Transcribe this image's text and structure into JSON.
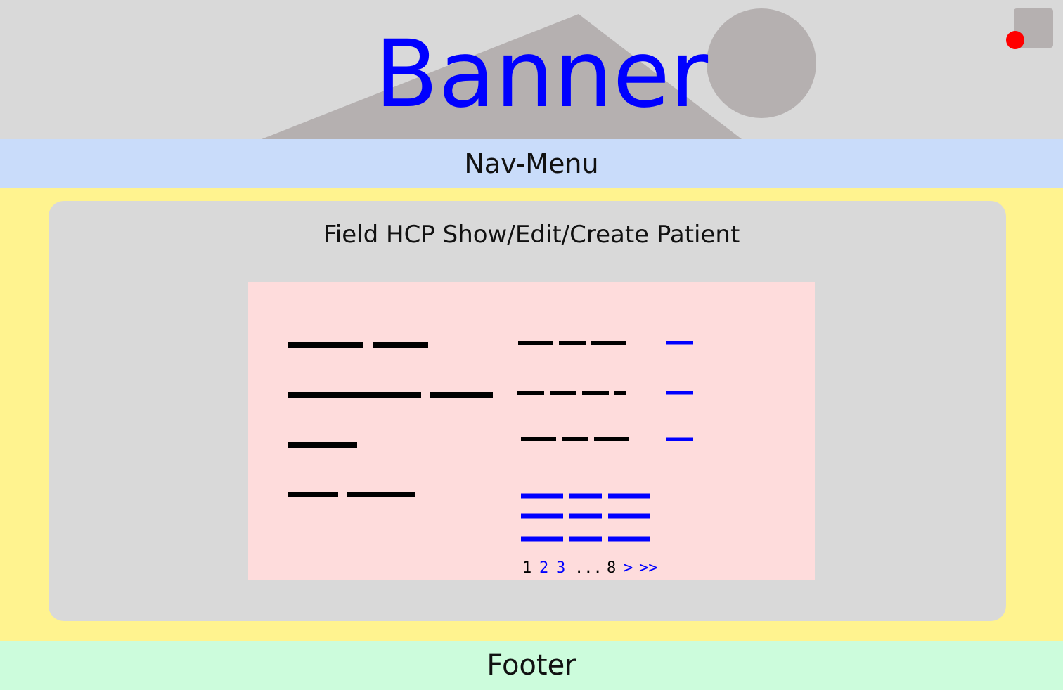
{
  "banner": {
    "title": "Banner"
  },
  "nav": {
    "label": "Nav-Menu"
  },
  "content": {
    "title": "Field HCP Show/Edit/Create Patient"
  },
  "pagination": {
    "page1": "1",
    "page2": "2",
    "page3": "3",
    "ellipsis": "...",
    "page_last": "8",
    "next": ">",
    "last": ">>"
  },
  "footer": {
    "label": "Footer"
  },
  "colors": {
    "banner_bg": "#d9d9d9",
    "nav_bg": "#c9dcfa",
    "page_bg": "#fff38f",
    "content_bg": "#d9d9d9",
    "panel_bg": "#fedcdc",
    "footer_bg": "#ccfcdc",
    "accent": "#0000ff",
    "notification": "#ff0000"
  }
}
